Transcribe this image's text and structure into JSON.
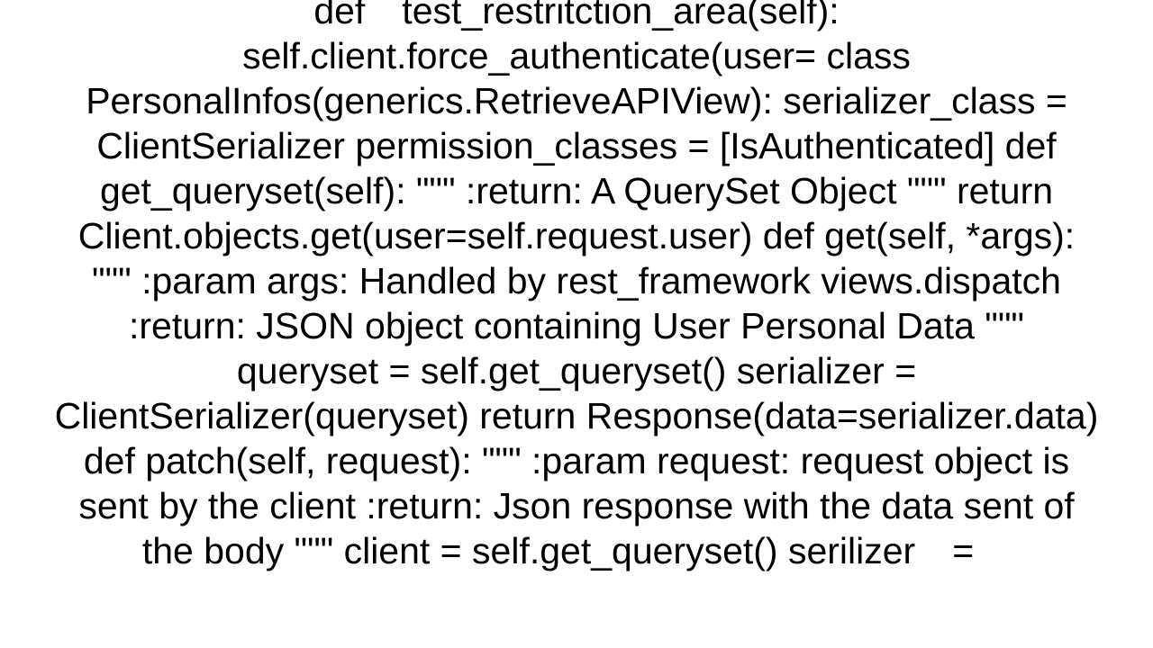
{
  "code_text": "    def test_restritction_area(self):         self.client.force_authenticate(user=   class PersonalInfos(generics.RetrieveAPIView):     serializer_class = ClientSerializer     permission_classes = [IsAuthenticated]      def get_queryset(self):         \"\"\"         :return: A QuerySet Object         \"\"\"         return Client.objects.get(user=self.request.user)      def get(self, *args):         \"\"\"         :param args: Handled by rest_framework views.dispatch         :return: JSON object containing User Personal Data         \"\"\"         queryset = self.get_queryset()         serializer = ClientSerializer(queryset)         return Response(data=serializer.data)      def patch(self, request):         \"\"\"         :param request: request object is sent by the client         :return:  Json response with the data sent of the body         \"\"\"         client = self.get_queryset()         serilizer = "
}
